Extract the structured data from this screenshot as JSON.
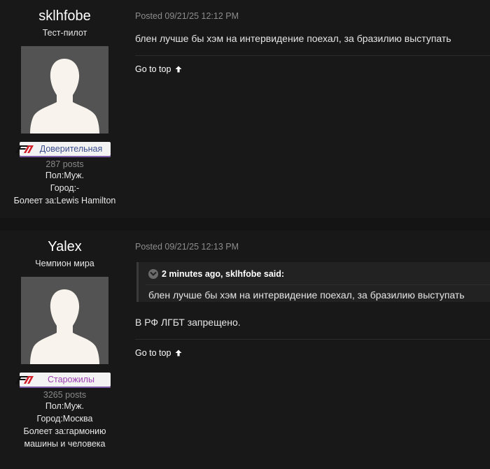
{
  "posts": [
    {
      "author": {
        "username": "sklhfobe",
        "rank": "Тест-пилот",
        "group": "Доверительная",
        "group_color": "#3a4c8c",
        "posts_count": "287 posts",
        "gender": "Пол:Муж.",
        "city": "Город:-",
        "fan_of": "Болеет за:Lewis Hamilton"
      },
      "posted": "Posted 09/21/25 12:12 PM",
      "text": "блен лучше бы хэм на интервидение поехал, за бразилию выступать",
      "go_to_top": "Go to top"
    },
    {
      "author": {
        "username": "Yalex",
        "rank": "Чемпион мира",
        "group": "Старожилы",
        "group_color": "#9a3fb0",
        "posts_count": "3265 posts",
        "gender": "Пол:Муж.",
        "city": "Город:Москва",
        "fan_of_line1": "Болеет за:гармонию",
        "fan_of_line2": "машины и человека"
      },
      "posted": "Posted 09/21/25 12:13 PM",
      "quote": {
        "header": "2 minutes ago, sklhfobe said:",
        "text": "блен лучше бы хэм на интервидение поехал, за бразилию выступать"
      },
      "text": "В РФ ЛГБТ запрещено.",
      "go_to_top": "Go to top"
    }
  ],
  "icons": {
    "avatar": "default-avatar-silhouette-icon",
    "group_logo": "f1-logo-icon",
    "go_top": "arrow-up-icon",
    "quote_toggle": "chevron-down-icon"
  },
  "colors": {
    "page_bg": "#141414",
    "post_bg": "#181818",
    "avatar_bg": "#535353",
    "badge_underline": "#7b5aa8"
  }
}
